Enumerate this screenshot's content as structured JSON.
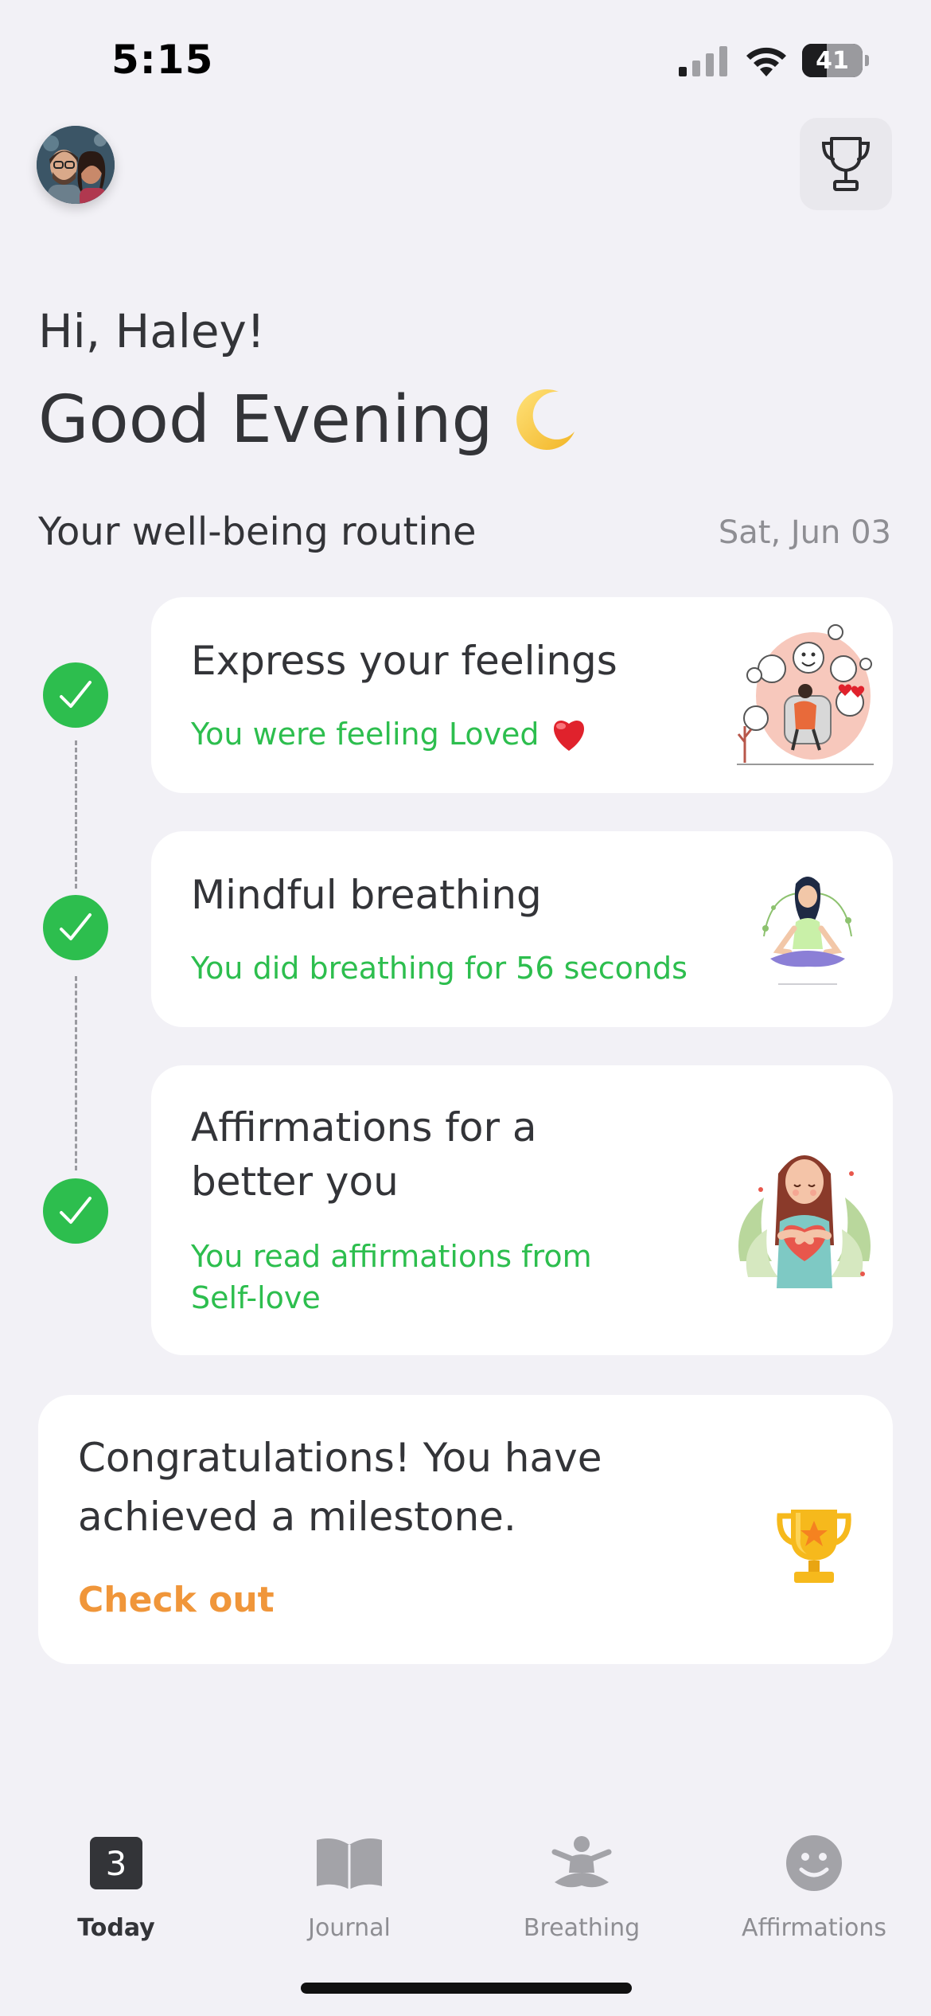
{
  "status_bar": {
    "time": "5:15",
    "battery_percent": "41"
  },
  "header": {
    "greeting": "Hi, Haley!",
    "salutation": "Good Evening",
    "moon_emoji": "🌙"
  },
  "routine": {
    "title": "Your well-being routine",
    "date": "Sat, Jun 03",
    "items": [
      {
        "title": "Express your feelings",
        "subtitle": "You were feeling Loved",
        "subtitle_emoji": "❤️",
        "completed": true
      },
      {
        "title": "Mindful breathing",
        "subtitle": "You did breathing for 56 seconds",
        "completed": true
      },
      {
        "title_line1": "Affirmations for a",
        "title_line2": "better you",
        "subtitle_line1": "You read affirmations from",
        "subtitle_line2": "Self-love",
        "completed": true
      }
    ]
  },
  "milestone": {
    "line1": "Congratulations! You have",
    "line2": "achieved a milestone.",
    "cta": "Check out"
  },
  "tabs": [
    {
      "label": "Today",
      "badge": "3",
      "icon": "calendar-day-icon",
      "active": true
    },
    {
      "label": "Journal",
      "icon": "book-icon",
      "active": false
    },
    {
      "label": "Breathing",
      "icon": "meditation-icon",
      "active": false
    },
    {
      "label": "Affirmations",
      "icon": "smiley-icon",
      "active": false
    }
  ],
  "colors": {
    "background": "#F2F1F6",
    "accent_green": "#2DBE4E",
    "accent_orange": "#F0963A",
    "text_primary": "#333438",
    "text_muted": "#8e8e93"
  }
}
